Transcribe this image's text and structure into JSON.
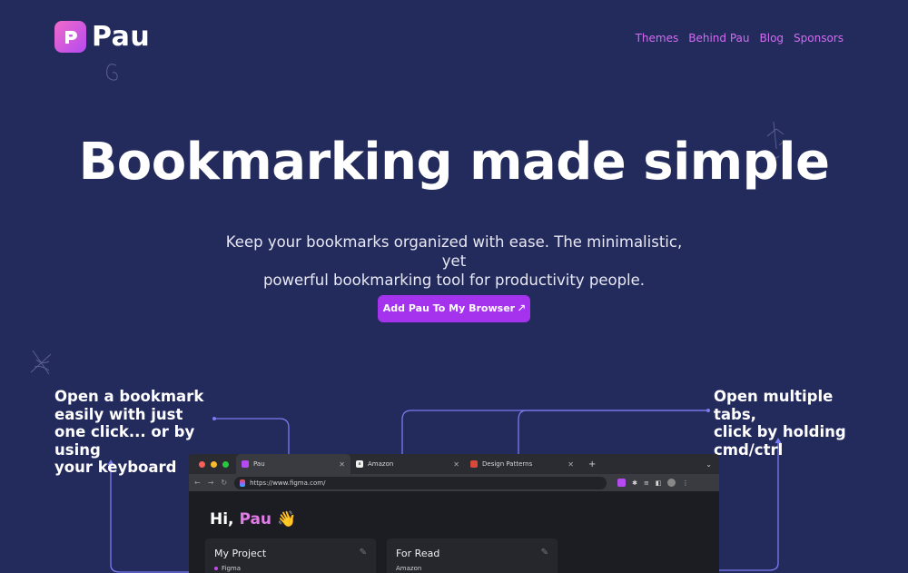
{
  "brand": {
    "name": "Pau",
    "logo_icon": "pau-logo-icon",
    "accent": "#a533ee",
    "link_color": "#d46cf2",
    "background": "#232a5c"
  },
  "nav": {
    "items": [
      {
        "label": "Themes"
      },
      {
        "label": "Behind Pau"
      },
      {
        "label": "Blog"
      },
      {
        "label": "Sponsors"
      }
    ]
  },
  "hero": {
    "title": "Bookmarking made simple",
    "subtitle_line1": "Keep your bookmarks organized with ease. The minimalistic, yet",
    "subtitle_line2": "powerful bookmarking tool for productivity people.",
    "cta_label": "Add Pau To My Browser 🡕"
  },
  "callouts": {
    "left": [
      "Open a bookmark",
      "easily with just",
      "one click... or by using",
      "your keyboard"
    ],
    "right": [
      "Open multiple tabs,",
      "click by holding",
      "cmd/ctrl"
    ]
  },
  "browser": {
    "tabs": [
      {
        "label": "Pau",
        "close": "✕"
      },
      {
        "label": "Amazon",
        "close": "✕"
      },
      {
        "label": "Design Patterns",
        "close": "✕"
      }
    ],
    "new_tab": "+",
    "url": "https://www.figma.com/",
    "greeting_prefix": "Hi, ",
    "greeting_name": "Pau",
    "greeting_emoji": "👋",
    "cards": [
      {
        "title": "My Project",
        "item": "Figma"
      },
      {
        "title": "For Read",
        "item": "Amazon"
      }
    ]
  }
}
